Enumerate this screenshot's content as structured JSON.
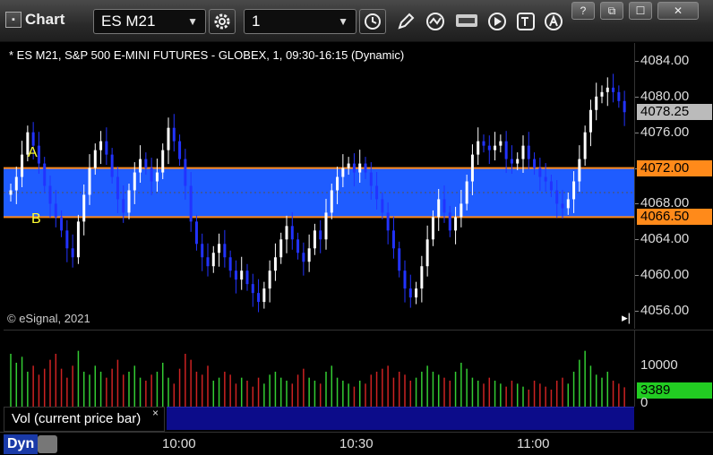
{
  "toolbar": {
    "app_title": "Chart",
    "symbol": "ES M21",
    "interval": "1",
    "colors": {
      "accent": "#1a3aa8"
    }
  },
  "chart": {
    "caption": "* ES M21, S&P 500 E-MINI FUTURES - GLOBEX, 1, 09:30-16:15 (Dynamic)",
    "copyright": "© eSignal, 2021",
    "markers": {
      "a": "A",
      "b": "B"
    },
    "price_axis": {
      "ticks": [
        "4084.00",
        "4080.00",
        "4076.00",
        "4072.00",
        "4068.00",
        "4064.00",
        "4060.00",
        "4056.00"
      ],
      "tags": {
        "last": "4078.25",
        "upper": "4072.00",
        "lower": "4066.50"
      }
    },
    "volume_axis": {
      "top_label": "10000",
      "zero_label": "0",
      "last_volume": "3389"
    },
    "volume_legend": "Vol (current price bar)",
    "volume_close": "×",
    "time_axis": {
      "dyn_label": "Dyn",
      "labels": [
        "10:00",
        "10:30",
        "11:00"
      ]
    }
  },
  "chart_data": {
    "type": "candlestick",
    "ylim": [
      4054,
      4086
    ],
    "zone": {
      "upper": 4072.0,
      "lower": 4066.5
    },
    "last_price": 4078.25,
    "colors": {
      "up_candle": "#ffffff",
      "down_candle": "#2233ff",
      "zone_fill": "#1f5cff",
      "zone_line": "#ff8a1a",
      "vol_up": "#33cc33",
      "vol_down": "#cc2222",
      "last_tag": "#bbbbbb",
      "zone_tag": "#ff8a1a",
      "vol_tag": "#22cc22"
    },
    "closes": [
      4069.5,
      4071.0,
      4073.5,
      4076.0,
      4074.5,
      4072.5,
      4070.0,
      4068.0,
      4066.5,
      4065.0,
      4063.0,
      4062.0,
      4066.0,
      4069.0,
      4072.0,
      4074.0,
      4075.0,
      4073.5,
      4071.0,
      4068.5,
      4067.0,
      4069.5,
      4071.5,
      4073.0,
      4072.0,
      4070.5,
      4071.5,
      4074.0,
      4076.5,
      4075.0,
      4073.0,
      4070.0,
      4066.0,
      4063.5,
      4062.0,
      4061.0,
      4062.5,
      4063.5,
      4062.0,
      4060.5,
      4059.5,
      4060.5,
      4059.0,
      4058.0,
      4057.0,
      4058.5,
      4060.5,
      4062.0,
      4064.0,
      4065.5,
      4064.0,
      4062.5,
      4061.5,
      4063.0,
      4065.0,
      4064.0,
      4067.0,
      4069.5,
      4071.0,
      4072.0,
      4072.5,
      4071.5,
      4072.5,
      4071.5,
      4070.0,
      4068.5,
      4067.0,
      4065.0,
      4063.0,
      4060.5,
      4058.5,
      4057.5,
      4058.5,
      4061.0,
      4064.0,
      4066.5,
      4068.5,
      4067.0,
      4065.0,
      4066.5,
      4068.0,
      4070.5,
      4073.5,
      4075.0,
      4074.5,
      4074.0,
      4074.5,
      4075.0,
      4073.0,
      4072.5,
      4073.0,
      4074.5,
      4073.0,
      4072.0,
      4071.0,
      4070.5,
      4069.5,
      4068.0,
      4067.5,
      4068.5,
      4070.5,
      4073.0,
      4076.0,
      4078.5,
      4080.0,
      4080.5,
      4081.0,
      4080.5,
      4079.5,
      4078.25
    ],
    "volumes": [
      9000,
      7500,
      8500,
      6000,
      7000,
      5500,
      6500,
      8000,
      9000,
      6500,
      5000,
      7000,
      9500,
      6000,
      5500,
      7000,
      6000,
      5000,
      6500,
      8000,
      5500,
      6000,
      7000,
      5000,
      4500,
      5500,
      6000,
      7500,
      5000,
      4000,
      6500,
      9000,
      8000,
      6000,
      5500,
      7000,
      4500,
      5000,
      6000,
      5500,
      4000,
      5000,
      4500,
      3500,
      5000,
      4000,
      5500,
      6000,
      5000,
      4500,
      4000,
      5500,
      6500,
      5000,
      4500,
      4000,
      6000,
      7000,
      5000,
      4500,
      4000,
      3500,
      4500,
      4000,
      5500,
      6000,
      6500,
      7000,
      5000,
      6000,
      5500,
      4500,
      5000,
      6000,
      7000,
      6000,
      5500,
      5000,
      4500,
      6000,
      7500,
      6500,
      5000,
      4500,
      4000,
      5000,
      4500,
      4000,
      3500,
      4500,
      4000,
      3500,
      3000,
      4500,
      4000,
      3500,
      3000,
      4500,
      5000,
      4000,
      6000,
      8000,
      9500,
      7000,
      5500,
      5000,
      6000,
      4500,
      4000,
      3389
    ],
    "vol_ylim": [
      0,
      12000
    ]
  }
}
